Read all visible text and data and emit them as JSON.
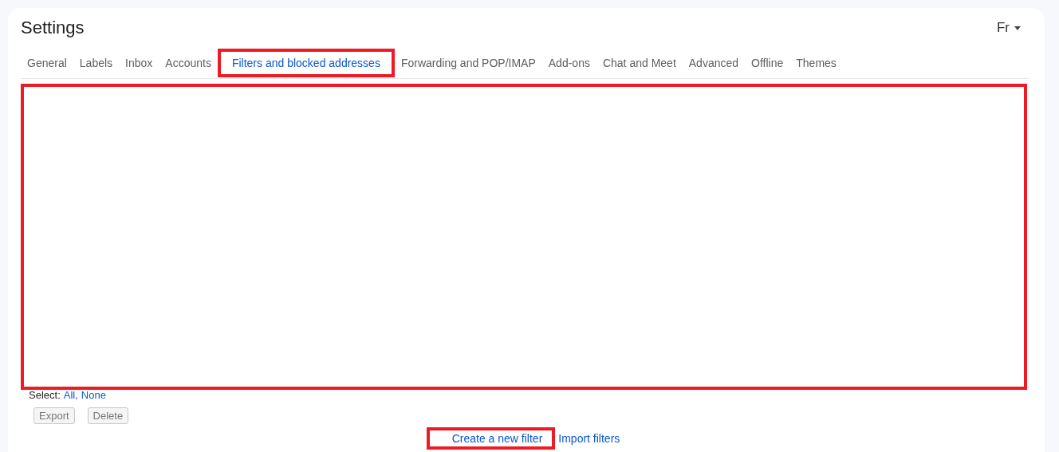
{
  "title": "Settings",
  "input_tools": {
    "label": "Fr"
  },
  "tabs": [
    {
      "label": "General",
      "selected": false,
      "highlighted": false
    },
    {
      "label": "Labels",
      "selected": false,
      "highlighted": false
    },
    {
      "label": "Inbox",
      "selected": false,
      "highlighted": false
    },
    {
      "label": "Accounts",
      "selected": false,
      "highlighted": false
    },
    {
      "label": "Filters and blocked addresses",
      "selected": true,
      "highlighted": true
    },
    {
      "label": "Forwarding and POP/IMAP",
      "selected": false,
      "highlighted": false
    },
    {
      "label": "Add-ons",
      "selected": false,
      "highlighted": false
    },
    {
      "label": "Chat and Meet",
      "selected": false,
      "highlighted": false
    },
    {
      "label": "Advanced",
      "selected": false,
      "highlighted": false
    },
    {
      "label": "Offline",
      "selected": false,
      "highlighted": false
    },
    {
      "label": "Themes",
      "selected": false,
      "highlighted": false
    }
  ],
  "filter_list": {
    "highlighted": true
  },
  "select": {
    "label": "Select:",
    "options": [
      "All,",
      "None"
    ]
  },
  "buttons": [
    {
      "label": "Export",
      "disabled": true
    },
    {
      "label": "Delete",
      "disabled": true
    }
  ],
  "links": [
    {
      "label": "Create a new filter",
      "highlighted": true
    },
    {
      "label": "Import filters",
      "highlighted": false
    }
  ]
}
